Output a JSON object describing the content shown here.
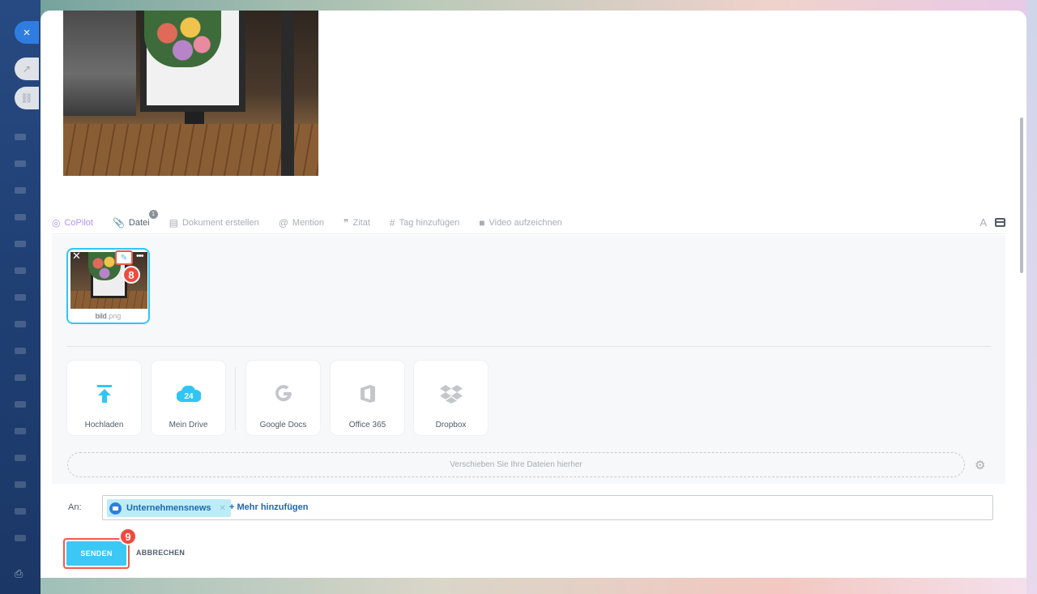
{
  "sidebar": {
    "close_icon": "×",
    "open_icon": "↗",
    "link_icon": "🔗"
  },
  "toolbar": {
    "items": [
      {
        "label": "CoPilot",
        "icon": "copilot-icon"
      },
      {
        "label": "Datei",
        "icon": "paperclip-icon",
        "badge": "1"
      },
      {
        "label": "Dokument erstellen",
        "icon": "document-icon"
      },
      {
        "label": "Mention",
        "icon": "at-icon"
      },
      {
        "label": "Zitat",
        "icon": "quote-icon"
      },
      {
        "label": "Tag hinzufügen",
        "icon": "hash-icon"
      },
      {
        "label": "Video aufzeichnen",
        "icon": "video-icon"
      }
    ],
    "font_label": "A"
  },
  "attachment": {
    "name": "bild",
    "ext": ".png",
    "step_badge": "8"
  },
  "sources": [
    {
      "label": "Hochladen",
      "icon": "upload-icon"
    },
    {
      "label": "Mein Drive",
      "icon": "drive-cloud-icon",
      "badge": "24"
    },
    {
      "label": "Google Docs",
      "icon": "google-icon"
    },
    {
      "label": "Office 365",
      "icon": "office-icon"
    },
    {
      "label": "Dropbox",
      "icon": "dropbox-icon"
    }
  ],
  "dropzone": {
    "text": "Verschieben Sie Ihre Dateien hierher"
  },
  "recipients": {
    "label": "An:",
    "chip": "Unternehmensnews",
    "add_more": "+ Mehr hinzufügen"
  },
  "actions": {
    "send": "SENDEN",
    "cancel": "ABBRECHEN",
    "step_badge": "9"
  },
  "colors": {
    "accent": "#3bc8f5",
    "highlight": "#ef5a4e",
    "link": "#2067b0"
  }
}
